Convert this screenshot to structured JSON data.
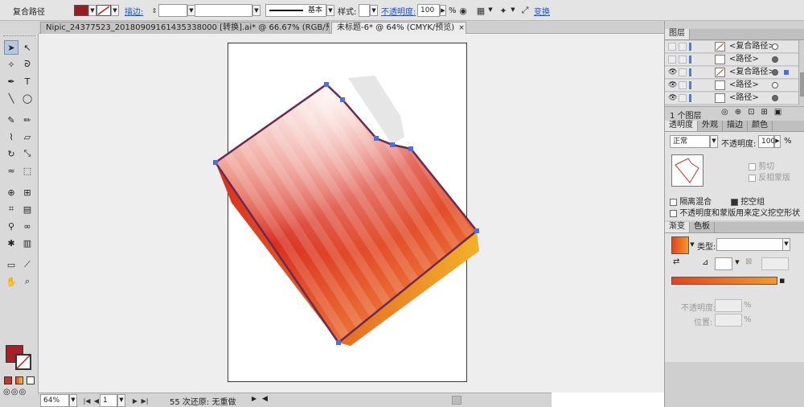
{
  "control_bar": {
    "selection_label": "复合路径",
    "fill_color": "#9b1b22",
    "stroke_label": "描边:",
    "stroke_width_value": "",
    "brush_value": "",
    "profile_label": "基本",
    "style_label": "样式:",
    "opacity_label": "不透明度:",
    "opacity_value": "100",
    "percent_unit": "%",
    "transform_label": "变换"
  },
  "tabs": [
    {
      "title": "Nipic_24377523_20180909161435338000 [转换].ai* @ 66.67% (RGB/预览)",
      "close": "×",
      "active": false
    },
    {
      "title": "未标题-6* @ 64% (CMYK/预览)",
      "close": "×",
      "active": true
    }
  ],
  "toolbox": {
    "fill_color": "#a5212a",
    "tools": [
      "selection-tool",
      "direct-selection-tool",
      "magic-wand-tool",
      "lasso-tool",
      "pen-tool",
      "type-tool",
      "line-tool",
      "ellipse-tool",
      "paintbrush-tool",
      "pencil-tool",
      "blob-brush-tool",
      "eraser-tool",
      "rotate-tool",
      "scale-tool",
      "warp-tool",
      "free-transform-tool",
      "shape-builder-tool",
      "perspective-tool",
      "mesh-tool",
      "gradient-tool",
      "eyedropper-tool",
      "blend-tool",
      "symbol-sprayer-tool",
      "column-graph-tool",
      "artboard-tool",
      "slice-tool",
      "hand-tool",
      "zoom-tool"
    ]
  },
  "status_bar": {
    "zoom_value": "64%",
    "page_value": "1",
    "status_text": "55 次还原: 无重做",
    "arrow": "▶"
  },
  "layers_panel": {
    "tab_label": "图层",
    "rows": [
      {
        "name": "<复合路径>",
        "visible": false,
        "target_filled": false
      },
      {
        "name": "<路径>",
        "visible": false,
        "target_filled": true
      },
      {
        "name": "<复合路径>",
        "visible": true,
        "target_filled": true
      },
      {
        "name": "<路径>",
        "visible": true,
        "target_filled": false
      },
      {
        "name": "<路径>",
        "visible": true,
        "target_filled": true
      }
    ],
    "footer_label": "1 个图层"
  },
  "transparency_panel": {
    "tabs": [
      "透明度",
      "外观",
      "描边",
      "颜色"
    ],
    "blend_mode": "正常",
    "opacity_label": "不透明度:",
    "opacity_value": "100",
    "percent_unit": "%",
    "clip_label": "剪切",
    "invert_mask_label": "反相蒙版",
    "isolate_blending_label": "隔离混合",
    "knockout_group_label": "挖空组",
    "opacity_mask_label": "不透明度和蒙版用来定义挖空形状"
  },
  "gradient_panel": {
    "tabs": [
      "渐变",
      "色板"
    ],
    "type_label": "类型:",
    "type_value": "",
    "opacity_label": "不透明度:",
    "location_label": "位置:",
    "percent_unit": "%",
    "swatch_colors": [
      "#e8431f",
      "#f09a2c"
    ]
  },
  "artwork_colors": {
    "shadow": "#e6e6e6",
    "dark_red": "#d92f20",
    "light": "#fbe1d4",
    "orange": "#ee7a3a",
    "yellow": "#f3b12a",
    "outline": "#6a2a52",
    "anchor": "#4a6fe0"
  }
}
